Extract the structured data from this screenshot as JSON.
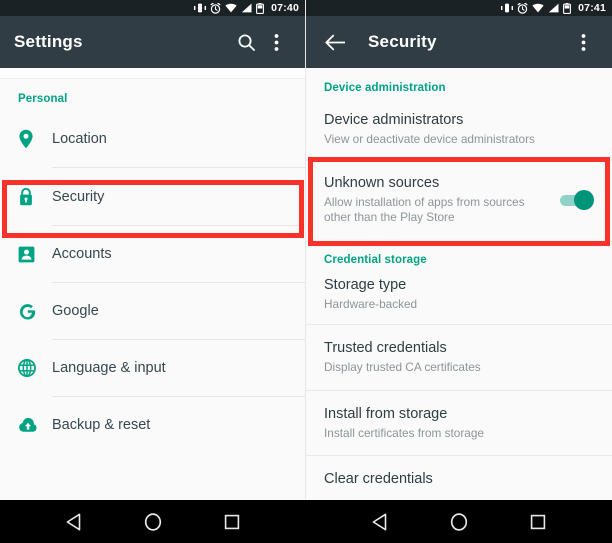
{
  "left": {
    "statusbar": {
      "time": "07:40",
      "icons": [
        "vibrate-icon",
        "alarm-icon",
        "wifi-icon",
        "signal-icon",
        "battery-icon"
      ]
    },
    "appbar": {
      "title": "Settings",
      "search_label": "search-icon",
      "overflow_label": "more-options-icon"
    },
    "section_header": "Personal",
    "items": [
      {
        "label": "Location",
        "icon": "location-pin-icon"
      },
      {
        "label": "Security",
        "icon": "lock-icon",
        "highlighted": true
      },
      {
        "label": "Accounts",
        "icon": "account-icon"
      },
      {
        "label": "Google",
        "icon": "google-g-icon"
      },
      {
        "label": "Language & input",
        "icon": "globe-icon"
      },
      {
        "label": "Backup & reset",
        "icon": "cloud-upload-icon"
      }
    ]
  },
  "right": {
    "statusbar": {
      "time": "07:41",
      "icons": [
        "vibrate-icon",
        "alarm-icon",
        "wifi-icon",
        "signal-icon",
        "battery-icon"
      ]
    },
    "appbar": {
      "title": "Security",
      "back_label": "back-arrow-icon",
      "overflow_label": "more-options-icon"
    },
    "sections": [
      {
        "header": "Device administration",
        "rows": [
          {
            "title": "Device administrators",
            "subtitle": "View or deactivate device administrators"
          },
          {
            "title": "Unknown sources",
            "subtitle": "Allow installation of apps from sources other than the Play Store",
            "toggle": "on",
            "highlighted": true
          }
        ]
      },
      {
        "header": "Credential storage",
        "rows": [
          {
            "title": "Storage type",
            "subtitle": "Hardware-backed"
          },
          {
            "title": "Trusted credentials",
            "subtitle": "Display trusted CA certificates"
          },
          {
            "title": "Install from storage",
            "subtitle": "Install certificates from storage"
          },
          {
            "title": "Clear credentials",
            "subtitle": ""
          }
        ]
      }
    ]
  },
  "navbar": {
    "back": "back-triangle-icon",
    "home": "home-circle-icon",
    "recents": "recents-square-icon"
  },
  "colors": {
    "accent_teal": "#00a383",
    "appbar": "#303d45",
    "statusbar": "#1b2226",
    "highlight_red": "#f8312a",
    "toggle_on": "#009478",
    "page_bg": "#fafafa"
  }
}
